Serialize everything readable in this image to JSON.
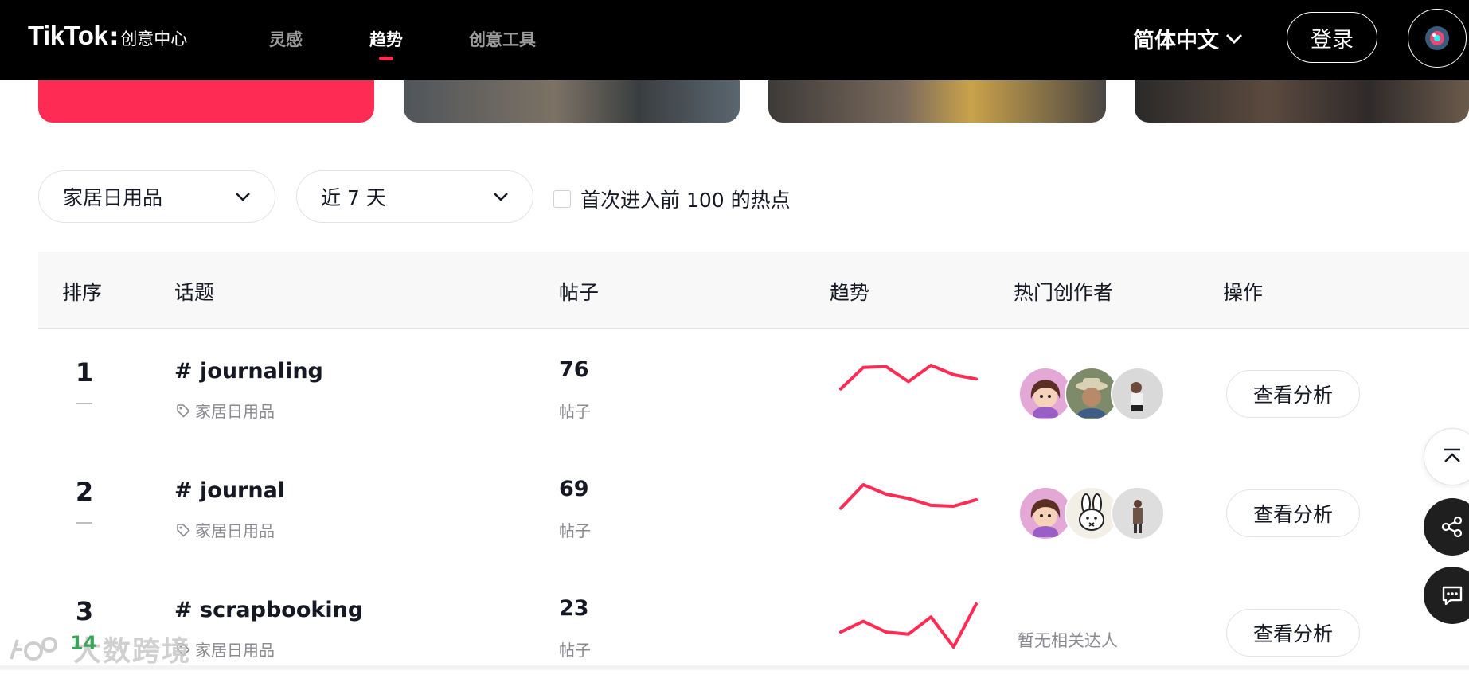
{
  "nav": {
    "logo_main": "TikTok",
    "logo_sep": ":",
    "logo_sub": "创意中心",
    "items": [
      {
        "label": "灵感",
        "active": false
      },
      {
        "label": "趋势",
        "active": true
      },
      {
        "label": "创意工具",
        "active": false
      }
    ],
    "language": "简体中文",
    "login": "登录",
    "accent_color": "#fe2c55"
  },
  "filters": {
    "industry": "家居日用品",
    "period": "近 7 天",
    "checkbox_label": "首次进入前 100 的热点",
    "checkbox_checked": false
  },
  "table": {
    "headers": {
      "rank": "排序",
      "topic": "话题",
      "posts": "帖子",
      "trend": "趋势",
      "creators": "热门创作者",
      "action": "操作"
    },
    "rows": [
      {
        "rank": "1",
        "topic": "# journaling",
        "category": "家居日用品",
        "posts": "76",
        "posts_label": "帖子",
        "trend": [
          0.45,
          0.95,
          0.97,
          0.62,
          1.0,
          0.78,
          0.68
        ],
        "creators": [
          "cartoon-girl-avatar",
          "hat-man-avatar",
          "woman-avatar"
        ],
        "no_creators": "",
        "action": "查看分析"
      },
      {
        "rank": "2",
        "topic": "# journal",
        "category": "家居日用品",
        "posts": "69",
        "posts_label": "帖子",
        "trend": [
          0.45,
          1.0,
          0.78,
          0.68,
          0.52,
          0.5,
          0.65
        ],
        "creators": [
          "cartoon-girl-avatar",
          "bunny-avatar",
          "woman-standing-avatar"
        ],
        "no_creators": "",
        "action": "查看分析"
      },
      {
        "rank": "3",
        "topic": "# scrapbooking",
        "category": "家居日用品",
        "posts": "23",
        "posts_label": "帖子",
        "trend": [
          0.35,
          0.6,
          0.35,
          0.3,
          0.7,
          0.0,
          1.0
        ],
        "creators": [],
        "no_creators": "暂无相关达人",
        "action": "查看分析"
      }
    ]
  },
  "watermark": {
    "text": "大数跨境",
    "badge": "14"
  },
  "icons": {
    "chevron": "chevron-down-icon",
    "tag": "tag-icon",
    "back_to_top": "back-to-top-icon",
    "share": "share-icon",
    "chat": "chat-icon"
  }
}
